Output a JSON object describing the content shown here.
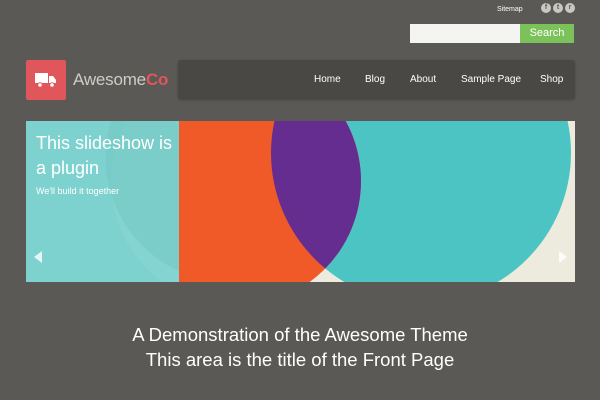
{
  "header": {
    "sitemap_label": "Sitemap",
    "social_icons": [
      {
        "icon": "facebook-icon",
        "glyph": "f"
      },
      {
        "icon": "twitter-icon",
        "glyph": "t"
      },
      {
        "icon": "rss-icon",
        "glyph": "r"
      }
    ],
    "search": {
      "placeholder": "",
      "value": "",
      "button_label": "Search"
    }
  },
  "logo": {
    "text_light": "Awesome",
    "text_bold": "Co",
    "icon": "truck-icon"
  },
  "nav": {
    "items": [
      {
        "label": "Home"
      },
      {
        "label": "Blog"
      },
      {
        "label": "About"
      },
      {
        "label": "Sample Page"
      },
      {
        "label": "Shop"
      }
    ]
  },
  "slideshow": {
    "title": "This slideshow is a plugin",
    "subtitle": "We'll build it together",
    "prev_icon": "chevron-left-icon",
    "next_icon": "chevron-right-icon"
  },
  "front_page": {
    "line1": "A Demonstration of the Awesome Theme",
    "line2": "This area is the title of the Front Page"
  },
  "colors": {
    "background": "#5b5955",
    "accent": "#e0565a",
    "search_button": "#7cc25a",
    "nav_background": "#4a4845",
    "teal": "#4cc4c3",
    "orange": "#f05a28",
    "purple": "#662d91",
    "cream": "#ecebde"
  }
}
